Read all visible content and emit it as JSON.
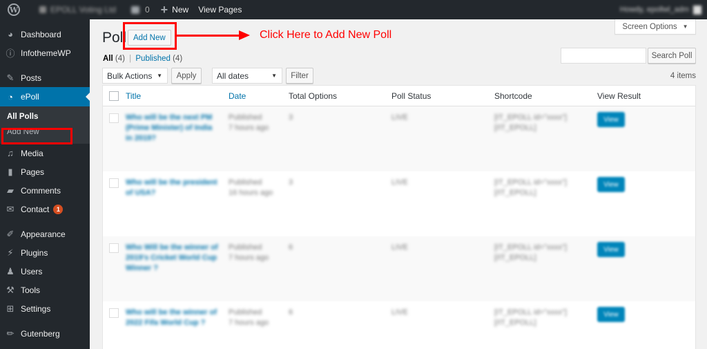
{
  "adminbar": {
    "logo": "W",
    "site_name": "EPOLL Voting Ltd",
    "comments_count": "0",
    "new_label": "New",
    "view_pages_label": "View Pages",
    "howdy": "Howdy, epollwl_adm"
  },
  "sidebar": {
    "items": [
      {
        "label": "Dashboard",
        "icon": "dashboard-icon"
      },
      {
        "label": "InfothemeWP",
        "icon": "info-icon"
      },
      {
        "label": "Posts",
        "icon": "pin-icon"
      },
      {
        "label": "ePoll",
        "icon": "pie-chart-icon",
        "current": true
      },
      {
        "label": "Media",
        "icon": "media-icon"
      },
      {
        "label": "Pages",
        "icon": "pages-icon"
      },
      {
        "label": "Comments",
        "icon": "comment-icon"
      },
      {
        "label": "Contact",
        "icon": "mail-icon",
        "badge": "1"
      },
      {
        "label": "Appearance",
        "icon": "brush-icon"
      },
      {
        "label": "Plugins",
        "icon": "plug-icon"
      },
      {
        "label": "Users",
        "icon": "user-icon"
      },
      {
        "label": "Tools",
        "icon": "wrench-icon"
      },
      {
        "label": "Settings",
        "icon": "sliders-icon"
      },
      {
        "label": "Gutenberg",
        "icon": "pencil-icon"
      }
    ],
    "submenu": [
      {
        "label": "All Polls",
        "current": true
      },
      {
        "label": "Add New"
      }
    ]
  },
  "main": {
    "screen_options": "Screen Options",
    "title": "Poll",
    "add_new": "Add New",
    "annotation": "Click Here to Add New Poll",
    "filters": {
      "all_label": "All",
      "all_count": "(4)",
      "separator": "|",
      "published_label": "Published",
      "published_count": "(4)"
    },
    "search_button": "Search Poll",
    "search_value": "",
    "bulk_actions": "Bulk Actions",
    "apply": "Apply",
    "all_dates": "All dates",
    "filter": "Filter",
    "items_count": "4 items",
    "columns": [
      "Title",
      "Date",
      "Total Options",
      "Poll Status",
      "Shortcode",
      "View Result"
    ],
    "rows": [
      {
        "title": "Who will be the next PM (Prime Minister) of India in 2019?",
        "status_line": "Published",
        "date": "7 hours ago",
        "options": "3",
        "poll_status": "LIVE",
        "shortcode": "[IT_EPOLL id=\"xxxx\"] [/IT_EPOLL]",
        "view": "View"
      },
      {
        "title": "Who will be the president of USA?",
        "status_line": "Published",
        "date": "16 hours ago",
        "options": "3",
        "poll_status": "LIVE",
        "shortcode": "[IT_EPOLL id=\"xxxx\"] [/IT_EPOLL]",
        "view": "View"
      },
      {
        "title": "Who Will be the winner of 2019's Cricket World Cup Winner ?",
        "status_line": "Published",
        "date": "7 hours ago",
        "options": "6",
        "poll_status": "LIVE",
        "shortcode": "[IT_EPOLL id=\"xxxx\"] [/IT_EPOLL]",
        "view": "View"
      },
      {
        "title": "Who will be the winner of 2022 Fifa World Cup ?",
        "status_line": "Published",
        "date": "7 hours ago",
        "options": "6",
        "poll_status": "LIVE",
        "shortcode": "[IT_EPOLL id=\"xxxx\"] [/IT_EPOLL]",
        "view": "View"
      }
    ]
  },
  "colors": {
    "adminbar_bg": "#23282d",
    "sidebar_bg": "#23282d",
    "accent": "#0073aa",
    "annotation": "#ff0000",
    "badge": "#d54e21",
    "view_button": "#0085ba"
  }
}
